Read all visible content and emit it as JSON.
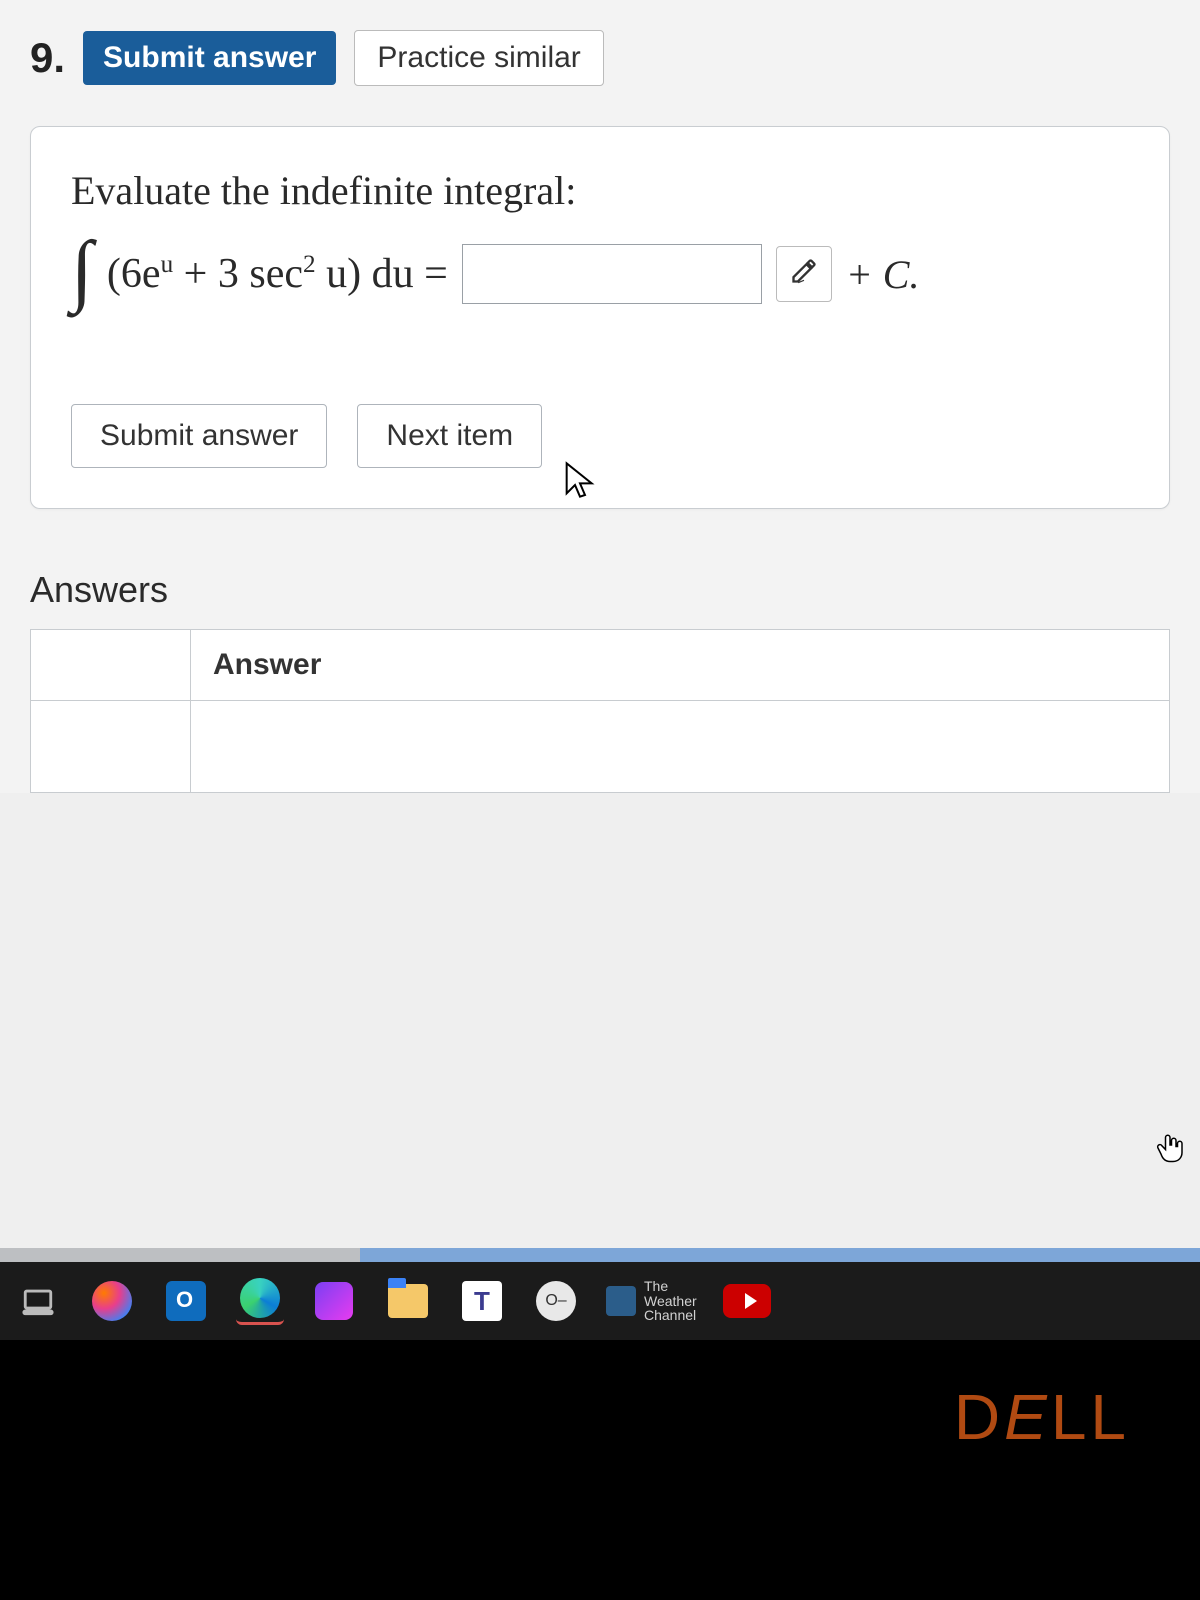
{
  "header": {
    "question_number": "9.",
    "submit_top": "Submit answer",
    "practice_similar": "Practice similar"
  },
  "question": {
    "prompt": "Evaluate the indefinite integral:",
    "integral_symbol": "∫",
    "expr_open": "(6e",
    "expr_sup1": "u",
    "expr_mid": " + 3 sec",
    "expr_sup2": "2",
    "expr_after": " u)  du =",
    "answer_value": "",
    "plus_c": "+ C.",
    "submit_btn": "Submit answer",
    "next_btn": "Next item"
  },
  "answers": {
    "heading": "Answers",
    "col_blank": "",
    "col_answer": "Answer"
  },
  "taskbar": {
    "teams_letter": "T",
    "round_label": "O–",
    "weather_line1": "The",
    "weather_line2": "Weather",
    "weather_line3": "Channel"
  },
  "bezel": {
    "brand": "DELL"
  }
}
